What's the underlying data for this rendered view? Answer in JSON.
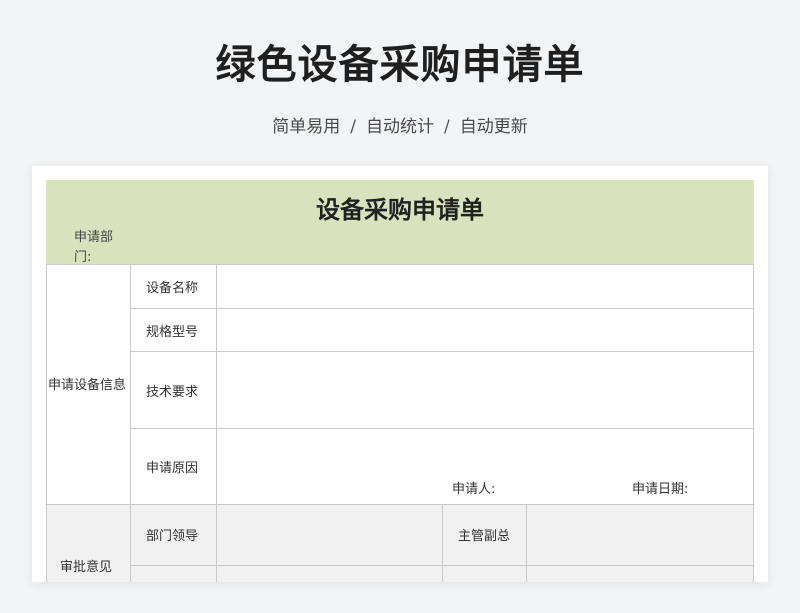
{
  "page": {
    "title": "绿色设备采购申请单",
    "subtitle_items": [
      "简单易用",
      "自动统计",
      "自动更新"
    ],
    "subtitle_separator": "/"
  },
  "form": {
    "title": "设备采购申请单",
    "dept_label": "申请部门:",
    "section_info": "申请设备信息",
    "rows": {
      "device_name": "设备名称",
      "spec_model": "规格型号",
      "tech_req": "技术要求",
      "reason": "申请原因"
    },
    "applicant_label": "申请人:",
    "apply_date_label": "申请日期:",
    "section_approval": "审批意见",
    "dept_leader": "部门领导",
    "deputy_manager": "主管副总"
  },
  "colors": {
    "header_band": "#d8e3bd",
    "background": "#f3f4f6",
    "grid": "#c9c9c9"
  }
}
